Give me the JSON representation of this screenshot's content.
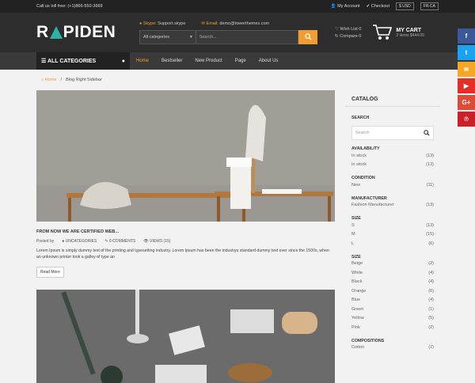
{
  "topbar": {
    "phone": "Call us toll free: (+1)866-550-3669",
    "account": "My Account",
    "checkout": "Checkout",
    "currency": "$ USD",
    "lang": "FR-CA"
  },
  "header": {
    "logo": {
      "a": "R",
      "b": "PIDEN"
    },
    "skype_key": "Skype:",
    "skype": "Support.skype",
    "email_key": "Email:",
    "email": "demo@towerthemes.com",
    "category_select": "All categories",
    "search_placeholder": "Search...",
    "wishlist": "Wish List 0",
    "compare": "Compare 0",
    "cart_title": "MY CART",
    "cart_sub": "2 items $444.00"
  },
  "nav": {
    "all_categories": "ALL CATEGORIES",
    "items": [
      "Home",
      "Bestseller",
      "New Product",
      "Page",
      "About Us"
    ]
  },
  "breadcrumb": {
    "home": "Home",
    "sep": "/",
    "current": "Blog Right Sidebar"
  },
  "post": {
    "title": "FROM NOW WE ARE CERTIFIED WEB...",
    "posted_by": "Posted by",
    "category": "UNCATEGORIES",
    "comments": "0 COMMENTS",
    "views": "VIEWS (15)",
    "excerpt": "Lorem Ipsum is simply dummy text of the printing and typesetting industry. Lorem Ipsum has been the industrys standard dummy text ever since the 1500s, when an unknown printer took a galley of type an",
    "read_more": "Read More"
  },
  "sidebar": {
    "title": "CATALOG",
    "search_h": "SEARCH",
    "search_placeholder": "Search",
    "availability_h": "AVAILABILITY",
    "availability": [
      {
        "l": "In stock",
        "c": "(13)"
      },
      {
        "l": "In stock",
        "c": "(13)"
      }
    ],
    "condition_h": "CONDITION",
    "condition": [
      {
        "l": "New",
        "c": "(11)"
      }
    ],
    "manufacturer_h": "MANUFACTURER",
    "manufacturer": [
      {
        "l": "Fashion Manufacturer",
        "c": "(13)"
      }
    ],
    "size_h": "SIZE",
    "size": [
      {
        "l": "S",
        "c": "(13)"
      },
      {
        "l": "M",
        "c": "(15)"
      },
      {
        "l": "L",
        "c": "(6)"
      }
    ],
    "color_h": "SIZE",
    "colors": [
      {
        "l": "Beige",
        "c": "(2)"
      },
      {
        "l": "White",
        "c": "(4)"
      },
      {
        "l": "Black",
        "c": "(4)"
      },
      {
        "l": "Orange",
        "c": "(6)"
      },
      {
        "l": "Blue",
        "c": "(4)"
      },
      {
        "l": "Green",
        "c": "(1)"
      },
      {
        "l": "Yellow",
        "c": "(5)"
      },
      {
        "l": "Pink",
        "c": "(2)"
      }
    ],
    "compositions_h": "COMPOSITIONS",
    "compositions": [
      {
        "l": "Cotton",
        "c": "(2)"
      }
    ]
  },
  "social": [
    {
      "icon": "f",
      "name": "facebook-icon",
      "color": "#3b5998"
    },
    {
      "icon": "t",
      "name": "twitter-icon",
      "color": "#1da1f2"
    },
    {
      "icon": "≋",
      "name": "rss-icon",
      "color": "#f5a623"
    },
    {
      "icon": "▶",
      "name": "youtube-icon",
      "color": "#e52d27"
    },
    {
      "icon": "G+",
      "name": "google-plus-icon",
      "color": "#dd4b39"
    },
    {
      "icon": "℗",
      "name": "pinterest-icon",
      "color": "#cb2027"
    }
  ],
  "colors": {
    "accent": "#f39c2f",
    "dark": "#2d2d2d",
    "teal": "#2ab3a6"
  }
}
